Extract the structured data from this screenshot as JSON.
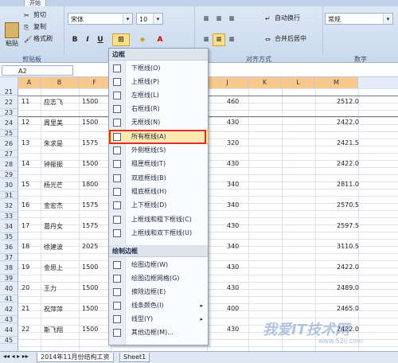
{
  "ribbon": {
    "tabs": [
      "开始"
    ],
    "clipboard": {
      "cut": "剪切",
      "copy": "复制",
      "format_painter": "格式刷",
      "paste": "粘贴",
      "group_label": "剪贴板"
    },
    "font": {
      "family": "宋体",
      "size": "10",
      "bold": "B",
      "italic": "I",
      "underline": "U",
      "fontcolor": "A"
    },
    "alignment": {
      "wrap": "自动换行",
      "merge": "合并后居中",
      "group_label": "对齐方式"
    },
    "number": {
      "format": "常规",
      "group_label": "数字"
    }
  },
  "formula": {
    "name_box": "A2",
    "fx": "fx"
  },
  "columns": [
    "A",
    "B",
    "F",
    "",
    "",
    "",
    "J",
    "K",
    "L",
    "M"
  ],
  "rows": [
    "21",
    "22",
    "23",
    "24",
    "25",
    "26",
    "27",
    "28",
    "29",
    "30",
    "31",
    "32",
    "33",
    "34",
    "35",
    "36",
    "37",
    "38",
    "39",
    "40",
    "41",
    "42",
    "43",
    "44",
    "45"
  ],
  "cells": [
    {
      "row": "22",
      "a": "11",
      "b": "应志飞",
      "f": "1500",
      "j": "460",
      "m": "2512.0"
    },
    {
      "row": "24",
      "a": "12",
      "b": "周里美",
      "f": "1500",
      "j": "430",
      "m": "2422.0"
    },
    {
      "row": "26",
      "a": "13",
      "b": "朱求是",
      "f": "1575",
      "j": "320",
      "m": "2421.5"
    },
    {
      "row": "28",
      "a": "14",
      "b": "钟振振",
      "f": "1500",
      "j": "430",
      "m": "2422.0"
    },
    {
      "row": "30",
      "a": "15",
      "b": "杨光芒",
      "f": "1800",
      "j": "340",
      "m": "2811.0"
    },
    {
      "row": "32",
      "a": "16",
      "b": "金宏杰",
      "f": "1575",
      "j": "340",
      "m": "2570.5"
    },
    {
      "row": "34",
      "a": "17",
      "b": "葛丹女",
      "f": "1575",
      "j": "430",
      "m": "2597.5"
    },
    {
      "row": "36",
      "a": "18",
      "b": "徐建波",
      "f": "2025",
      "j": "340",
      "m": "3110.5"
    },
    {
      "row": "38",
      "a": "19",
      "b": "金思上",
      "f": "1500",
      "j": "430",
      "m": "2422.0"
    },
    {
      "row": "40",
      "a": "20",
      "b": "王力",
      "f": "1500",
      "j": "430",
      "m": "2489.0"
    },
    {
      "row": "42",
      "a": "21",
      "b": "祝萍萍",
      "f": "1500",
      "j": "400",
      "m": "2465.0"
    },
    {
      "row": "44",
      "a": "22",
      "b": "斯飞翔",
      "f": "1500",
      "j": "430",
      "m": "2422.0"
    }
  ],
  "menu": {
    "header1": "边框",
    "items": [
      {
        "label": "下框线(O)"
      },
      {
        "label": "上框线(P)"
      },
      {
        "label": "左框线(L)"
      },
      {
        "label": "右框线(R)"
      },
      {
        "label": "无框线(N)"
      },
      {
        "label": "所有框线(A)",
        "highlight": true
      },
      {
        "label": "外侧框线(S)"
      },
      {
        "label": "粗匣框线(T)"
      },
      {
        "label": "双底框线(B)"
      },
      {
        "label": "粗底框线(H)"
      },
      {
        "label": "上下框线(D)"
      },
      {
        "label": "上框线和粗下框线(C)"
      },
      {
        "label": "上框线和双下框线(U)"
      }
    ],
    "header2": "绘制边框",
    "items2": [
      {
        "label": "绘图边框(W)"
      },
      {
        "label": "绘图边框网格(G)"
      },
      {
        "label": "擦除边框(E)"
      },
      {
        "label": "线条颜色(I)",
        "sub": true
      },
      {
        "label": "线型(Y)",
        "sub": true
      },
      {
        "label": "其他边框(M)..."
      }
    ]
  },
  "sheets": [
    "2014年11月份结构工资",
    "Sheet1"
  ],
  "watermark": {
    "text": "我爱IT技术网",
    "sub": "www.52ij.com"
  }
}
